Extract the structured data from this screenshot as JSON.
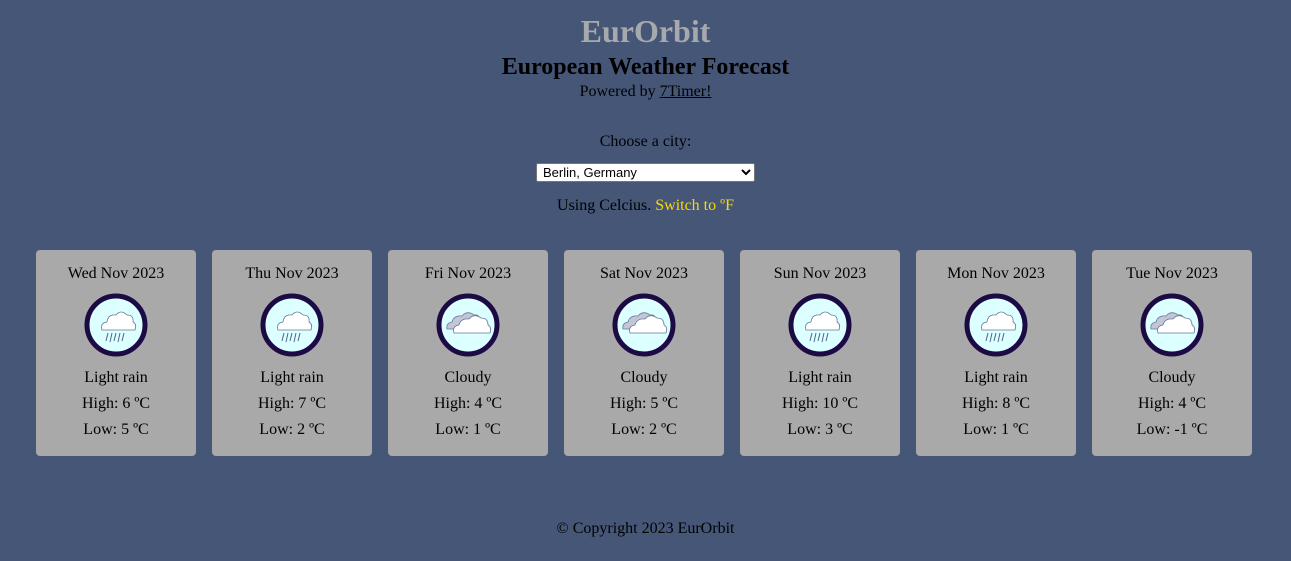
{
  "header": {
    "brand": "EurOrbit",
    "subtitle": "European Weather Forecast",
    "powered_prefix": "Powered by ",
    "powered_link": "7Timer!"
  },
  "city_picker": {
    "label": "Choose a city:",
    "selected": "Berlin, Germany"
  },
  "units": {
    "current": "Using Celcius.",
    "switch_label": "Switch to ºF"
  },
  "forecast": [
    {
      "date": "Wed Nov 2023",
      "icon": "light-rain-icon",
      "desc": "Light rain",
      "high": "High: 6 ºC",
      "low": "Low: 5 ºC"
    },
    {
      "date": "Thu Nov 2023",
      "icon": "light-rain-icon",
      "desc": "Light rain",
      "high": "High: 7 ºC",
      "low": "Low: 2 ºC"
    },
    {
      "date": "Fri Nov 2023",
      "icon": "cloudy-icon",
      "desc": "Cloudy",
      "high": "High: 4 ºC",
      "low": "Low: 1 ºC"
    },
    {
      "date": "Sat Nov 2023",
      "icon": "cloudy-icon",
      "desc": "Cloudy",
      "high": "High: 5 ºC",
      "low": "Low: 2 ºC"
    },
    {
      "date": "Sun Nov 2023",
      "icon": "light-rain-icon",
      "desc": "Light rain",
      "high": "High: 10 ºC",
      "low": "Low: 3 ºC"
    },
    {
      "date": "Mon Nov 2023",
      "icon": "light-rain-icon",
      "desc": "Light rain",
      "high": "High: 8 ºC",
      "low": "Low: 1 ºC"
    },
    {
      "date": "Tue Nov 2023",
      "icon": "cloudy-icon",
      "desc": "Cloudy",
      "high": "High: 4 ºC",
      "low": "Low: -1 ºC"
    }
  ],
  "footer": {
    "copyright": "© Copyright 2023 EurOrbit"
  },
  "colors": {
    "background": "#465677",
    "card": "#a9a9a9",
    "brand": "#a6a9ad",
    "switch_link": "#f5d90a",
    "icon_ring": "#1c0a45",
    "icon_fill": "#dcffff"
  }
}
